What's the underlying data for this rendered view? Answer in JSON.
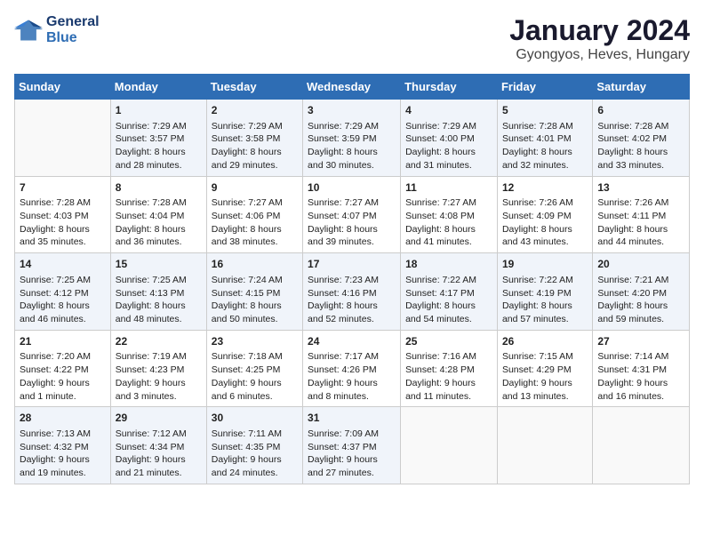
{
  "logo": {
    "line1": "General",
    "line2": "Blue"
  },
  "title": "January 2024",
  "location": "Gyongyos, Heves, Hungary",
  "days_of_week": [
    "Sunday",
    "Monday",
    "Tuesday",
    "Wednesday",
    "Thursday",
    "Friday",
    "Saturday"
  ],
  "weeks": [
    [
      {
        "day": "",
        "info": ""
      },
      {
        "day": "1",
        "info": "Sunrise: 7:29 AM\nSunset: 3:57 PM\nDaylight: 8 hours\nand 28 minutes."
      },
      {
        "day": "2",
        "info": "Sunrise: 7:29 AM\nSunset: 3:58 PM\nDaylight: 8 hours\nand 29 minutes."
      },
      {
        "day": "3",
        "info": "Sunrise: 7:29 AM\nSunset: 3:59 PM\nDaylight: 8 hours\nand 30 minutes."
      },
      {
        "day": "4",
        "info": "Sunrise: 7:29 AM\nSunset: 4:00 PM\nDaylight: 8 hours\nand 31 minutes."
      },
      {
        "day": "5",
        "info": "Sunrise: 7:28 AM\nSunset: 4:01 PM\nDaylight: 8 hours\nand 32 minutes."
      },
      {
        "day": "6",
        "info": "Sunrise: 7:28 AM\nSunset: 4:02 PM\nDaylight: 8 hours\nand 33 minutes."
      }
    ],
    [
      {
        "day": "7",
        "info": "Sunrise: 7:28 AM\nSunset: 4:03 PM\nDaylight: 8 hours\nand 35 minutes."
      },
      {
        "day": "8",
        "info": "Sunrise: 7:28 AM\nSunset: 4:04 PM\nDaylight: 8 hours\nand 36 minutes."
      },
      {
        "day": "9",
        "info": "Sunrise: 7:27 AM\nSunset: 4:06 PM\nDaylight: 8 hours\nand 38 minutes."
      },
      {
        "day": "10",
        "info": "Sunrise: 7:27 AM\nSunset: 4:07 PM\nDaylight: 8 hours\nand 39 minutes."
      },
      {
        "day": "11",
        "info": "Sunrise: 7:27 AM\nSunset: 4:08 PM\nDaylight: 8 hours\nand 41 minutes."
      },
      {
        "day": "12",
        "info": "Sunrise: 7:26 AM\nSunset: 4:09 PM\nDaylight: 8 hours\nand 43 minutes."
      },
      {
        "day": "13",
        "info": "Sunrise: 7:26 AM\nSunset: 4:11 PM\nDaylight: 8 hours\nand 44 minutes."
      }
    ],
    [
      {
        "day": "14",
        "info": "Sunrise: 7:25 AM\nSunset: 4:12 PM\nDaylight: 8 hours\nand 46 minutes."
      },
      {
        "day": "15",
        "info": "Sunrise: 7:25 AM\nSunset: 4:13 PM\nDaylight: 8 hours\nand 48 minutes."
      },
      {
        "day": "16",
        "info": "Sunrise: 7:24 AM\nSunset: 4:15 PM\nDaylight: 8 hours\nand 50 minutes."
      },
      {
        "day": "17",
        "info": "Sunrise: 7:23 AM\nSunset: 4:16 PM\nDaylight: 8 hours\nand 52 minutes."
      },
      {
        "day": "18",
        "info": "Sunrise: 7:22 AM\nSunset: 4:17 PM\nDaylight: 8 hours\nand 54 minutes."
      },
      {
        "day": "19",
        "info": "Sunrise: 7:22 AM\nSunset: 4:19 PM\nDaylight: 8 hours\nand 57 minutes."
      },
      {
        "day": "20",
        "info": "Sunrise: 7:21 AM\nSunset: 4:20 PM\nDaylight: 8 hours\nand 59 minutes."
      }
    ],
    [
      {
        "day": "21",
        "info": "Sunrise: 7:20 AM\nSunset: 4:22 PM\nDaylight: 9 hours\nand 1 minute."
      },
      {
        "day": "22",
        "info": "Sunrise: 7:19 AM\nSunset: 4:23 PM\nDaylight: 9 hours\nand 3 minutes."
      },
      {
        "day": "23",
        "info": "Sunrise: 7:18 AM\nSunset: 4:25 PM\nDaylight: 9 hours\nand 6 minutes."
      },
      {
        "day": "24",
        "info": "Sunrise: 7:17 AM\nSunset: 4:26 PM\nDaylight: 9 hours\nand 8 minutes."
      },
      {
        "day": "25",
        "info": "Sunrise: 7:16 AM\nSunset: 4:28 PM\nDaylight: 9 hours\nand 11 minutes."
      },
      {
        "day": "26",
        "info": "Sunrise: 7:15 AM\nSunset: 4:29 PM\nDaylight: 9 hours\nand 13 minutes."
      },
      {
        "day": "27",
        "info": "Sunrise: 7:14 AM\nSunset: 4:31 PM\nDaylight: 9 hours\nand 16 minutes."
      }
    ],
    [
      {
        "day": "28",
        "info": "Sunrise: 7:13 AM\nSunset: 4:32 PM\nDaylight: 9 hours\nand 19 minutes."
      },
      {
        "day": "29",
        "info": "Sunrise: 7:12 AM\nSunset: 4:34 PM\nDaylight: 9 hours\nand 21 minutes."
      },
      {
        "day": "30",
        "info": "Sunrise: 7:11 AM\nSunset: 4:35 PM\nDaylight: 9 hours\nand 24 minutes."
      },
      {
        "day": "31",
        "info": "Sunrise: 7:09 AM\nSunset: 4:37 PM\nDaylight: 9 hours\nand 27 minutes."
      },
      {
        "day": "",
        "info": ""
      },
      {
        "day": "",
        "info": ""
      },
      {
        "day": "",
        "info": ""
      }
    ]
  ]
}
